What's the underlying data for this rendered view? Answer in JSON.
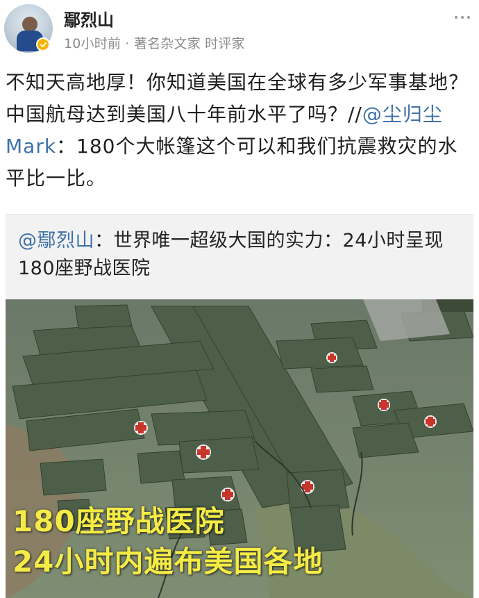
{
  "header": {
    "username": "鄢烈山",
    "meta": "10小时前 · 著名杂文家 时评家",
    "avatar_icon": "avatar-photo",
    "verify_icon": "verified-badge-icon",
    "more_icon": "more-options-icon"
  },
  "post": {
    "text_before": "不知天高地厚！你知道美国在全球有多少军事基地？中国航母达到美国八十年前水平了吗？//",
    "mention": "@尘归尘Mark",
    "text_after": "：180个大帐篷这个可以和我们抗震救灾的水平比一比。"
  },
  "quote": {
    "mention": "@鄢烈山",
    "text": "：世界唯一超级大国的实力：24小时呈现180座野战医院"
  },
  "photo": {
    "caption_line1": "180座野战医院",
    "caption_line2": "24小时内遍布美国各地"
  },
  "colors": {
    "mention": "#3e71a9",
    "caption": "#f4eb45",
    "tent_green": "#4b5b45",
    "red_cross": "#c8352d"
  }
}
